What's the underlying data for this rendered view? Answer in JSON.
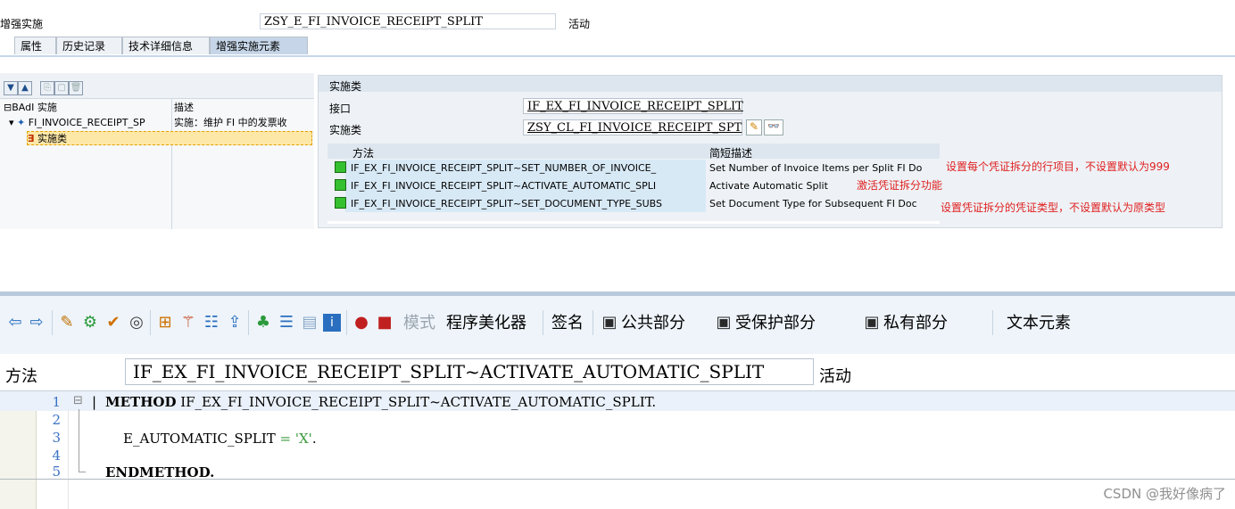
{
  "header": {
    "enh_impl_label": "增强实施",
    "enh_impl_value": "ZSY_E_FI_INVOICE_RECEIPT_SPLIT",
    "status": "活动"
  },
  "tabs": [
    {
      "label": "属性"
    },
    {
      "label": "历史记录"
    },
    {
      "label": "技术详细信息"
    },
    {
      "label": "增强实施元素"
    }
  ],
  "tree": {
    "col_impl": "BAdI 实施",
    "col_desc": "描述",
    "node_name": "FI_INVOICE_RECEIPT_SP",
    "node_desc": "实施：维护 FI 中的发票收",
    "child_label": "实施类"
  },
  "impl_class": {
    "section_title": "实施类",
    "interface_label": "接口",
    "interface_value": "IF_EX_FI_INVOICE_RECEIPT_SPLIT",
    "class_label": "实施类",
    "class_value": "ZSY_CL_FI_INVOICE_RECEIPT_SPT"
  },
  "methods": {
    "col_method": "方法",
    "col_desc": "简短描述",
    "rows": [
      {
        "name": "IF_EX_FI_INVOICE_RECEIPT_SPLIT~SET_NUMBER_OF_INVOICE_",
        "desc": "Set Number of Invoice Items per Split FI Do",
        "note": "设置每个凭证拆分的行项目，不设置默认为999"
      },
      {
        "name": "IF_EX_FI_INVOICE_RECEIPT_SPLIT~ACTIVATE_AUTOMATIC_SPLI",
        "desc": "Activate Automatic Split",
        "note": "激活凭证拆分功能"
      },
      {
        "name": "IF_EX_FI_INVOICE_RECEIPT_SPLIT~SET_DOCUMENT_TYPE_SUBS",
        "desc": "Set Document Type for Subsequent FI Doc",
        "note": "设置凭证拆分的凭证类型，不设置默认为原类型"
      }
    ]
  },
  "toolbar": {
    "mode": "模式",
    "pretty_printer": "程序美化器",
    "signature": "签名",
    "public_section": "公共部分",
    "protected_section": "受保护部分",
    "private_section": "私有部分",
    "text_elements": "文本元素"
  },
  "editor": {
    "method_label": "方法",
    "method_value": "IF_EX_FI_INVOICE_RECEIPT_SPLIT~ACTIVATE_AUTOMATIC_SPLIT",
    "status": "活动",
    "lines": [
      {
        "no": "1",
        "kw": "METHOD",
        "rest": " IF_EX_FI_INVOICE_RECEIPT_SPLIT~ACTIVATE_AUTOMATIC_SPLIT."
      },
      {
        "no": "2",
        "text": ""
      },
      {
        "no": "3",
        "var": "E_AUTOMATIC_SPLIT",
        "op": " = ",
        "str": "'X'",
        "end": "."
      },
      {
        "no": "4",
        "text": ""
      },
      {
        "no": "5",
        "kw": "ENDMETHOD."
      }
    ]
  },
  "watermark": "CSDN @我好像病了",
  "colors": {
    "accent": "#c6d6e8",
    "note": "#e02020",
    "line_no": "#3b72c4",
    "string": "#3a9a3a"
  }
}
